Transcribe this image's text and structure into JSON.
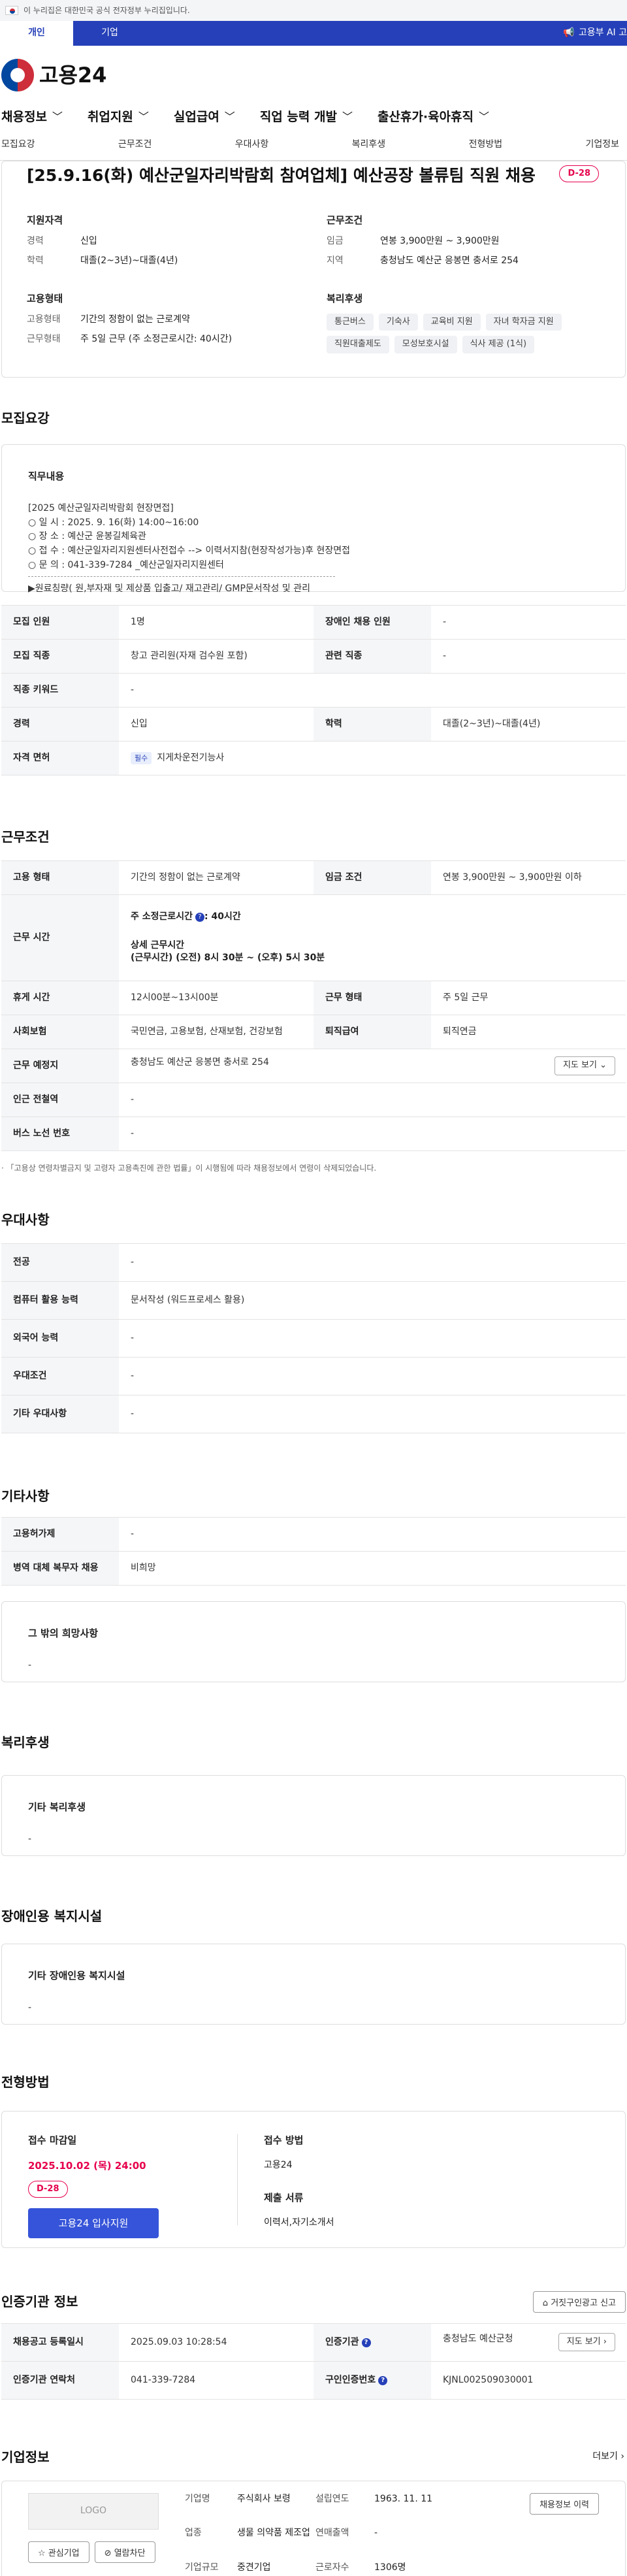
{
  "gov_banner": "이 누리집은 대한민국 공식 전자정부 누리집입니다.",
  "top_tabs": [
    "개인",
    "기업"
  ],
  "top_link": "고용부 AI 고",
  "logo_text": "고용24",
  "gnb": [
    "채용정보",
    "취업지원",
    "실업급여",
    "직업 능력 개발",
    "출산휴가·육아휴직"
  ],
  "anchors": [
    "모집요강",
    "근무조건",
    "우대사항",
    "복리후생",
    "전형방법",
    "기업정보"
  ],
  "title": "[25.9.16(화) 예산군일자리박람회 참여업체] 예산공장 볼류팀 직원 채용",
  "dday": "D-28",
  "summary": {
    "qual_title": "지원자격",
    "career_k": "경력",
    "career_v": "신입",
    "edu_k": "학력",
    "edu_v": "대졸(2~3년)~대졸(4년)",
    "cond_title": "근무조건",
    "wage_k": "임금",
    "wage_v": "연봉 3,900만원 ~ 3,900만원",
    "region_k": "지역",
    "region_v": "충청남도 예산군 응봉면 충서로 254",
    "emp_title": "고용형태",
    "emp_k": "고용형태",
    "emp_v": "기간의 정함이 없는 근로계약",
    "work_k": "근무형태",
    "work_v": "주 5일 근무 (주 소정근로시간: 40시간)",
    "welfare_title": "복리후생",
    "welfare_tags": [
      "통근버스",
      "기숙사",
      "교육비 지원",
      "자녀 학자금 지원",
      "직원대출제도",
      "모성보호시설",
      "식사 제공 (1식)"
    ]
  },
  "s_recruit": "모집요강",
  "job_content_title": "직무내용",
  "job_content": "[2025 예산군일자리박람회 현장면접]\n○ 일 시 : 2025. 9. 16(화) 14:00~16:00\n○ 장 소 : 예산군 윤봉길체육관\n○ 접 수 : 예산군일자리지원센터사전접수 --> 이력서지참(현장작성가능)후 현장면접\n○ 문 의 : 041-339-7284 _예산군일자리지원센터",
  "job_content2": "▶원료칭량( 원,부자재 및 제상품 입출고/ 재고관리/ GMP문서작성 및 관리",
  "recruit_table": {
    "count_k": "모집 인원",
    "count_v": "1명",
    "disabled_k": "장애인 채용 인원",
    "disabled_v": "-",
    "job_k": "모집 직종",
    "job_v": "창고 관리원(자재 검수원 포함)",
    "rel_k": "관련 직종",
    "rel_v": "-",
    "kw_k": "직종 키워드",
    "kw_v": "-",
    "career_k": "경력",
    "career_v": "신입",
    "edu_k": "학력",
    "edu_v": "대졸(2~3년)~대졸(4년)",
    "lic_k": "자격 면허",
    "lic_badge": "필수",
    "lic_v": "지게차운전기능사"
  },
  "s_cond": "근무조건",
  "cond_table": {
    "emp_k": "고용 형태",
    "emp_v": "기간의 정함이 없는 근로계약",
    "wage_k": "임금 조건",
    "wage_v": "연봉 3,900만원 ~ 3,900만원 이하",
    "time_k": "근무 시간",
    "time_main": "주 소정근로시간",
    "time_main_v": ": 40시간",
    "time_detail": "상세 근무시간",
    "time_detail_v": "(근무시간) (오전) 8시 30분 ~ (오후) 5시 30분",
    "rest_k": "휴게 시간",
    "rest_v": "12시00분~13시00분",
    "form_k": "근무 형태",
    "form_v": "주 5일 근무",
    "ins_k": "사회보험",
    "ins_v": "국민연금, 고용보험, 산재보험, 건강보험",
    "ret_k": "퇴직급여",
    "ret_v": "퇴직연금",
    "place_k": "근무 예정지",
    "place_v": "충청남도 예산군 응봉면 충서로 254",
    "map_btn": "지도 보기",
    "subway_k": "인근 전철역",
    "subway_v": "-",
    "bus_k": "버스 노선 번호",
    "bus_v": "-"
  },
  "cond_note": "「고용상 연령차별금지 및 고령자 고용촉진에 관한 법률」이 시행됨에 따라 채용정보에서 연령이 삭제되었습니다.",
  "s_pref": "우대사항",
  "pref_table": {
    "major_k": "전공",
    "major_v": "-",
    "pc_k": "컴퓨터 활용 능력",
    "pc_v": "문서작성 (워드프로세스 활용)",
    "lang_k": "외국어 능력",
    "lang_v": "-",
    "pcond_k": "우대조건",
    "pcond_v": "-",
    "etc_k": "기타 우대사항",
    "etc_v": "-"
  },
  "s_etc": "기타사항",
  "etc_table": {
    "permit_k": "고용허가제",
    "permit_v": "-",
    "mil_k": "병역 대체 복무자 채용",
    "mil_v": "비희망"
  },
  "etc_hope_title": "그 밖의 희망사항",
  "etc_hope_v": "-",
  "s_welfare": "복리후생",
  "welfare_box_title": "기타 복리후생",
  "welfare_box_v": "-",
  "s_disabled": "장애인용 복지시설",
  "disabled_box_title": "기타 장애인용 복지시설",
  "disabled_box_v": "-",
  "s_apply": "전형방법",
  "apply": {
    "deadline_k": "접수 마감일",
    "deadline_v": "2025.10.02 (목) 24:00",
    "dday": "D-28",
    "btn": "고용24 입사지원",
    "method_k": "접수 방법",
    "method_v": "고용24",
    "docs_k": "제출 서류",
    "docs_v": "이력서,자기소개서"
  },
  "s_cert": "인증기관 정보",
  "report_btn": "거짓구인광고 신고",
  "cert_table": {
    "reg_k": "채용공고 등록일시",
    "reg_v": "2025.09.03 10:28:54",
    "org_k": "인증기관",
    "org_v": "충청남도 예산군청",
    "map_btn": "지도 보기",
    "tel_k": "인증기관 연락처",
    "tel_v": "041-339-7284",
    "no_k": "구인인증번호",
    "no_v": "KJNL002509030001"
  },
  "s_company": "기업정보",
  "more": "더보기",
  "company": {
    "logo": "LOGO",
    "fav_btn": "관심기업",
    "block_btn": "열람차단",
    "name_k": "기업명",
    "name_v": "주식회사 보령",
    "ind_k": "업종",
    "ind_v": "생물 의약품 제조업",
    "size_k": "기업규모",
    "size_v": "중견기업",
    "est_k": "설립연도",
    "est_v": "1963. 11. 11",
    "sales_k": "연매출액",
    "sales_v": "-",
    "emp_k": "근로자수",
    "emp_v": "1306명",
    "jobs_btn": "채용정보 이력"
  }
}
